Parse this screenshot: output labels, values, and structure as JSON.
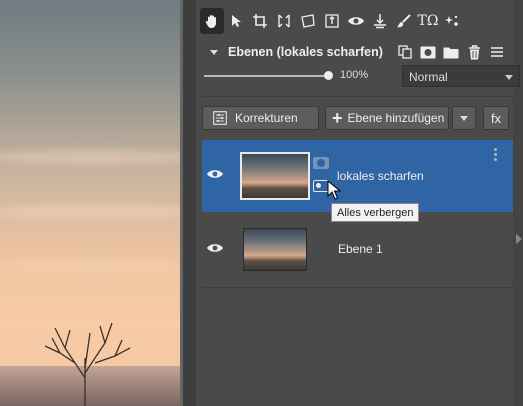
{
  "panel": {
    "title": "Ebenen (lokales scharfen)",
    "opacity_label": "100%",
    "opacity": 1.0,
    "blend_mode": "Normal"
  },
  "toolbar": {
    "tools": [
      "hand-icon",
      "pointer-icon",
      "crop-icon",
      "perspective-icon",
      "transform-icon",
      "text-frame-icon",
      "eye-icon",
      "level-icon",
      "brush-icon",
      "text-symbol-icon",
      "effects-icon"
    ],
    "text_tool_label": "TΩ"
  },
  "buttons": {
    "corrections_label": "Korrekturen",
    "add_layer_label": "Ebene hinzufügen",
    "fx_label": "fx"
  },
  "layers": [
    {
      "name": "lokales scharfen",
      "selected": true
    },
    {
      "name": "Ebene 1",
      "selected": false
    }
  ],
  "tooltip": {
    "text": "Alles verbergen"
  },
  "colors": {
    "selection": "#2f64a5",
    "panel_bg": "#4a4a4a"
  }
}
